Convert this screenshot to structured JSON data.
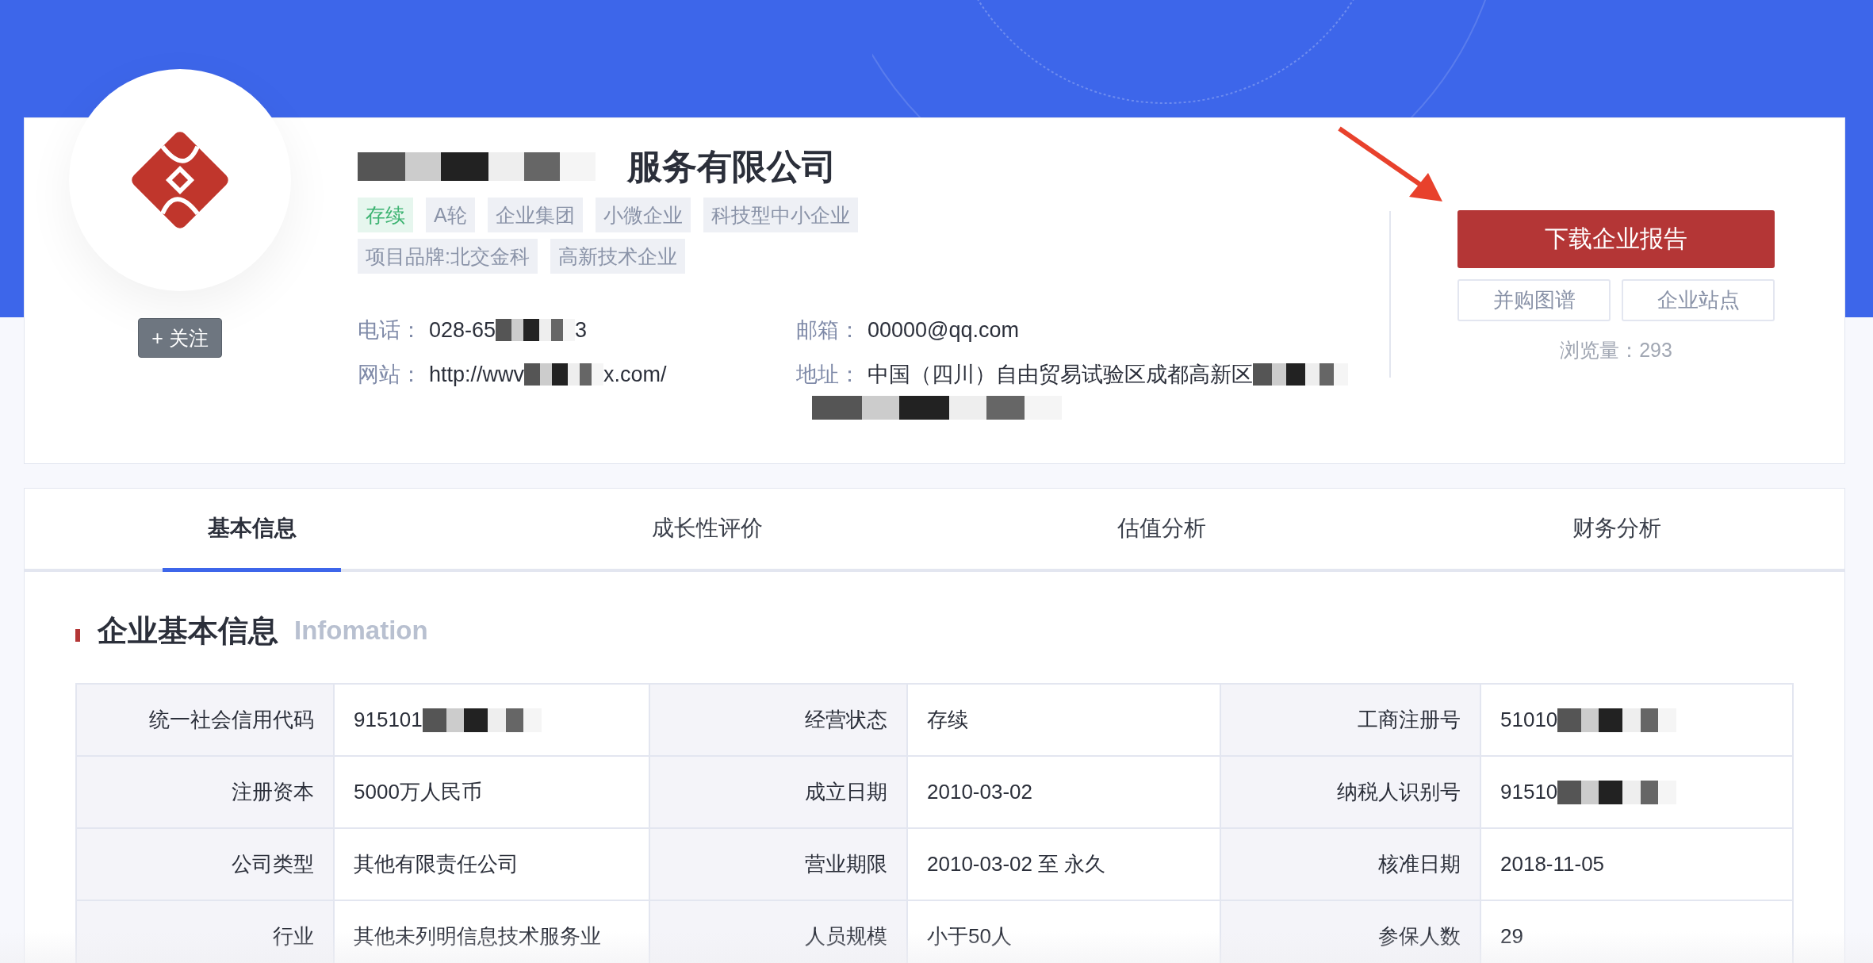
{
  "company": {
    "name": "服务有限公司",
    "name_redacted": true,
    "follow_button": "+ 关注",
    "tags": [
      {
        "label": "存续",
        "kind": "status"
      },
      {
        "label": "A轮",
        "kind": "plain"
      },
      {
        "label": "企业集团",
        "kind": "plain"
      },
      {
        "label": "小微企业",
        "kind": "plain"
      },
      {
        "label": "科技型中小企业",
        "kind": "plain"
      },
      {
        "label": "项目品牌:北交金科",
        "kind": "plain"
      },
      {
        "label": "高新技术企业",
        "kind": "plain"
      }
    ],
    "contacts": [
      {
        "label": "电话：",
        "value": "028-65",
        "tail": "3",
        "redacted": true
      },
      {
        "label": "邮箱：",
        "value": "00000@qq.com",
        "redacted": false
      },
      {
        "label": "网站：",
        "value": "http://wwv",
        "tail": "x.com/",
        "redacted": true
      },
      {
        "label": "地址：",
        "value": "中国（四川）自由贸易试验区成都高新区",
        "redacted": true
      }
    ]
  },
  "actions": {
    "primary": "下载企业报告",
    "secondary": [
      "并购图谱",
      "企业站点"
    ],
    "views": "浏览量：293"
  },
  "tabs": [
    {
      "label": "基本信息",
      "selected": true
    },
    {
      "label": "成长性评价",
      "selected": false
    },
    {
      "label": "估值分析",
      "selected": false
    },
    {
      "label": "财务分析",
      "selected": false
    }
  ],
  "section": {
    "title": "企业基本信息",
    "subtitle": "Infomation"
  },
  "table": {
    "rows": [
      [
        {
          "label": "统一社会信用代码",
          "value": "915101",
          "redacted": true
        },
        {
          "label": "经营状态",
          "value": "存续",
          "redacted": false
        },
        {
          "label": "工商注册号",
          "value": "51010",
          "redacted": true
        }
      ],
      [
        {
          "label": "注册资本",
          "value": "5000万人民币",
          "redacted": false
        },
        {
          "label": "成立日期",
          "value": "2010-03-02",
          "redacted": false
        },
        {
          "label": "纳税人识别号",
          "value": "91510",
          "redacted": true
        }
      ],
      [
        {
          "label": "公司类型",
          "value": "其他有限责任公司",
          "redacted": false
        },
        {
          "label": "营业期限",
          "value": "2010-03-02 至 永久",
          "redacted": false
        },
        {
          "label": "核准日期",
          "value": "2018-11-05",
          "redacted": false
        }
      ],
      [
        {
          "label": "行业",
          "value": "其他未列明信息技术服务业",
          "redacted": false
        },
        {
          "label": "人员规模",
          "value": "小于50人",
          "redacted": false
        },
        {
          "label": "参保人数",
          "value": "29",
          "redacted": false
        }
      ]
    ]
  }
}
